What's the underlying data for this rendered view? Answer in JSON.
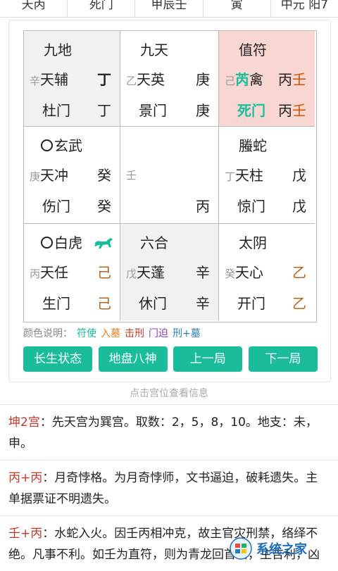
{
  "top_row": [
    "天丙",
    "死门",
    "甲辰壬",
    "寅",
    "中元 阳7"
  ],
  "grid": {
    "c11": {
      "god": "九地",
      "side1": "辛",
      "star": "天辅",
      "star_stem": "丁",
      "gate": "杜门",
      "gate_stem": "丁"
    },
    "c12": {
      "god": "九天",
      "side1": "乙",
      "star": "天英",
      "star_stem": "庚",
      "gate": "景门",
      "gate_stem": "庚"
    },
    "c13": {
      "god": "值符",
      "side1": "己",
      "star_a": "芮",
      "star_b": "禽",
      "star_stem_a": "丙",
      "star_stem_b": "壬",
      "gate": "死门",
      "gate_stem_a": "丙",
      "gate_stem_b": "壬"
    },
    "c21": {
      "god": "玄武",
      "side1": "庚",
      "star": "天冲",
      "star_stem": "癸",
      "gate": "伤门",
      "gate_stem": "癸"
    },
    "c22": {
      "side1": "壬",
      "gate_stem": "丙"
    },
    "c23": {
      "god": "螣蛇",
      "side1": "丁",
      "star": "天柱",
      "star_stem": "戊",
      "gate": "惊门",
      "gate_stem": "戊"
    },
    "c31": {
      "god": "白虎",
      "side1": "丙",
      "star": "天任",
      "star_stem": "己",
      "gate": "生门",
      "gate_stem": "己",
      "icon": "horse-icon"
    },
    "c32": {
      "god": "六合",
      "side1": "戊",
      "star": "天蓬",
      "star_stem": "辛",
      "gate": "休门",
      "gate_stem": "辛"
    },
    "c33": {
      "god": "太阴",
      "side1": "癸",
      "star": "天心",
      "star_stem": "乙",
      "gate": "开门",
      "gate_stem": "乙"
    }
  },
  "legend": {
    "label": "颜色说明：",
    "items": [
      {
        "text": "符使",
        "color": "#1abc9c"
      },
      {
        "text": "入墓",
        "color": "#e67e22"
      },
      {
        "text": "击刑",
        "color": "#c0392b"
      },
      {
        "text": "门迫",
        "color": "#8e44ad"
      },
      {
        "text": "刑+墓",
        "color": "#2980b9"
      }
    ]
  },
  "buttons": [
    "长生状态",
    "地盘八神",
    "上一局",
    "下一局"
  ],
  "hint": "点击宫位查看信息",
  "info": [
    {
      "head": "坤2宫",
      "body": "：先天宫为巽宫。取数：2，5，8，10。地支：未，申。"
    },
    {
      "head": "丙+丙",
      "body": "：月奇悖格。为月奇悖师，文书逼迫，破耗遗失。主单据票证不明遗失。"
    },
    {
      "head": "壬+丙",
      "body": "：水蛇入火。因壬丙相冲克，故主官灾刑禁，络绎不绝。凡事不利。如壬为直符，则为青龙回首格，主吉利，凶"
    }
  ],
  "watermark": "系统之家",
  "colors": {
    "teal": "#1abc9c",
    "pink": "#f8d7d3",
    "gray": "#f1f1f1",
    "orange": "#d35400",
    "brown": "#b5651d",
    "red": "#c0392b"
  }
}
